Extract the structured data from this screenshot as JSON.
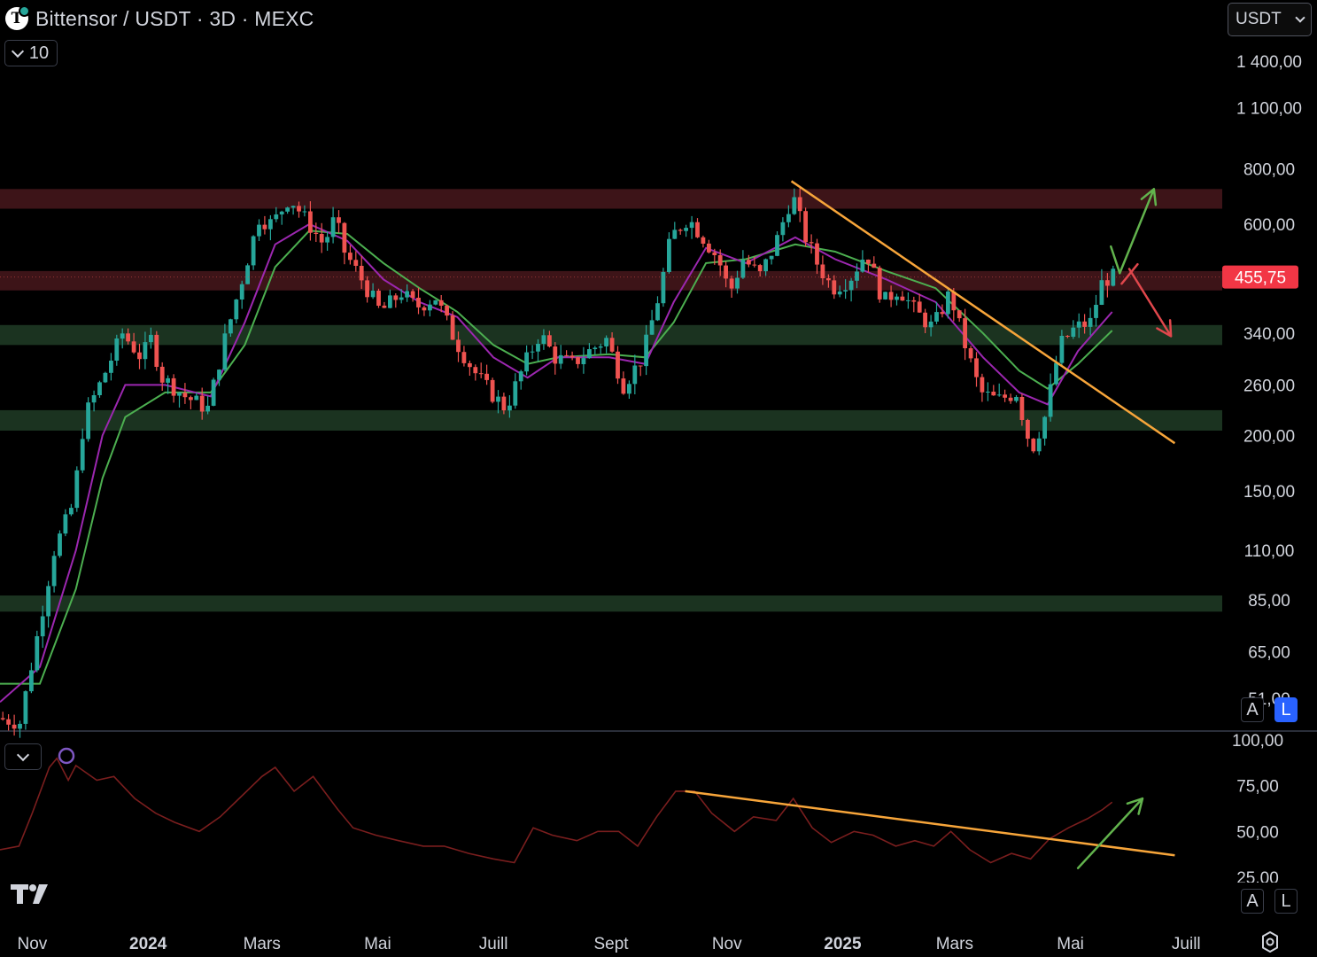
{
  "header": {
    "title": "Bittensor / USDT · 3D · MEXC",
    "logo_letter": "T",
    "period_value": "10",
    "currency": "USDT"
  },
  "price_axis": {
    "ticks": [
      "1 400,00",
      "1 100,00",
      "800,00",
      "600,00",
      "340,00",
      "260,00",
      "200,00",
      "150,00",
      "110,00",
      "85,00",
      "65,00",
      "51,00"
    ],
    "last_price_label": "455,75",
    "last_price_color": "#f23645",
    "scale_buttons": [
      "A",
      "L"
    ]
  },
  "indicator_axis": {
    "ticks": [
      "100,00",
      "75,00",
      "50,00",
      "25,00"
    ],
    "scale_buttons": [
      "A",
      "L"
    ]
  },
  "time_axis": {
    "ticks": [
      "Nov",
      "2024",
      "Mars",
      "Mai",
      "Juill",
      "Sept",
      "Nov",
      "2025",
      "Mars",
      "Mai",
      "Juill"
    ]
  },
  "colors": {
    "up": "#26a69a",
    "down": "#ef5350",
    "ema_fast": "#9c27b0",
    "ema_slow": "#4caf50",
    "trendline": "#f7a53a",
    "resistance_zone": "#3d1418",
    "support_zone": "#1b3320",
    "rsi_line": "#7a1e1e",
    "arrow_up": "#62b34d",
    "arrow_down": "#e0474c",
    "background": "#000000"
  },
  "chart_data": {
    "type": "candlestick",
    "scale": "log",
    "x_range": [
      "2023-10-15",
      "2025-07-20"
    ],
    "y_range": [
      44,
      1600
    ],
    "x_ticks": [
      "Nov",
      "2024",
      "Mars",
      "Mai",
      "Juill",
      "Sept",
      "Nov",
      "2025",
      "Mars",
      "Mai",
      "Juill"
    ],
    "y_ticks": [
      1400,
      1100,
      800,
      600,
      340,
      260,
      200,
      150,
      110,
      85,
      65,
      51
    ],
    "last_price": 455.75,
    "price_path": [
      [
        "2023-10-15",
        46
      ],
      [
        "2023-10-27",
        45
      ],
      [
        "2023-11-05",
        70
      ],
      [
        "2023-11-14",
        110
      ],
      [
        "2023-11-24",
        140
      ],
      [
        "2023-11-30",
        220
      ],
      [
        "2023-12-08",
        260
      ],
      [
        "2023-12-20",
        340
      ],
      [
        "2023-12-30",
        300
      ],
      [
        "2024-01-04",
        330
      ],
      [
        "2024-01-10",
        270
      ],
      [
        "2024-01-22",
        245
      ],
      [
        "2024-02-03",
        230
      ],
      [
        "2024-02-12",
        330
      ],
      [
        "2024-02-21",
        450
      ],
      [
        "2024-03-01",
        620
      ],
      [
        "2024-03-08",
        600
      ],
      [
        "2024-03-17",
        690
      ],
      [
        "2024-03-26",
        610
      ],
      [
        "2024-04-04",
        540
      ],
      [
        "2024-04-10",
        620
      ],
      [
        "2024-04-15",
        520
      ],
      [
        "2024-04-24",
        450
      ],
      [
        "2024-05-04",
        380
      ],
      [
        "2024-05-15",
        420
      ],
      [
        "2024-05-23",
        390
      ],
      [
        "2024-06-02",
        410
      ],
      [
        "2024-06-12",
        330
      ],
      [
        "2024-06-22",
        280
      ],
      [
        "2024-07-01",
        250
      ],
      [
        "2024-07-09",
        230
      ],
      [
        "2024-07-19",
        290
      ],
      [
        "2024-07-27",
        340
      ],
      [
        "2024-08-04",
        300
      ],
      [
        "2024-08-13",
        290
      ],
      [
        "2024-08-22",
        310
      ],
      [
        "2024-08-31",
        330
      ],
      [
        "2024-09-09",
        260
      ],
      [
        "2024-09-19",
        300
      ],
      [
        "2024-09-28",
        420
      ],
      [
        "2024-10-04",
        560
      ],
      [
        "2024-10-13",
        620
      ],
      [
        "2024-10-21",
        560
      ],
      [
        "2024-10-29",
        500
      ],
      [
        "2024-11-04",
        420
      ],
      [
        "2024-11-11",
        500
      ],
      [
        "2024-11-20",
        460
      ],
      [
        "2024-11-28",
        540
      ],
      [
        "2024-12-07",
        700
      ],
      [
        "2024-12-14",
        560
      ],
      [
        "2024-12-20",
        490
      ],
      [
        "2024-12-28",
        430
      ],
      [
        "2025-01-06",
        450
      ],
      [
        "2025-01-15",
        520
      ],
      [
        "2025-01-24",
        400
      ],
      [
        "2025-02-01",
        430
      ],
      [
        "2025-02-10",
        380
      ],
      [
        "2025-02-19",
        350
      ],
      [
        "2025-02-28",
        420
      ],
      [
        "2025-03-07",
        330
      ],
      [
        "2025-03-16",
        250
      ],
      [
        "2025-03-25",
        240
      ],
      [
        "2025-04-04",
        250
      ],
      [
        "2025-04-12",
        185
      ],
      [
        "2025-04-19",
        220
      ],
      [
        "2025-04-27",
        320
      ],
      [
        "2025-05-05",
        350
      ],
      [
        "2025-05-13",
        360
      ],
      [
        "2025-05-19",
        440
      ],
      [
        "2025-05-23",
        455.75
      ]
    ],
    "ema_fast_path": [
      [
        "2023-10-15",
        50
      ],
      [
        "2023-11-05",
        60
      ],
      [
        "2023-11-24",
        110
      ],
      [
        "2023-12-08",
        200
      ],
      [
        "2023-12-20",
        260
      ],
      [
        "2024-01-10",
        260
      ],
      [
        "2024-02-03",
        245
      ],
      [
        "2024-02-21",
        360
      ],
      [
        "2024-03-08",
        540
      ],
      [
        "2024-03-26",
        600
      ],
      [
        "2024-04-15",
        550
      ],
      [
        "2024-05-04",
        450
      ],
      [
        "2024-05-23",
        400
      ],
      [
        "2024-06-12",
        370
      ],
      [
        "2024-07-01",
        300
      ],
      [
        "2024-07-19",
        270
      ],
      [
        "2024-08-04",
        300
      ],
      [
        "2024-08-31",
        300
      ],
      [
        "2024-09-19",
        290
      ],
      [
        "2024-10-04",
        400
      ],
      [
        "2024-10-21",
        530
      ],
      [
        "2024-11-11",
        490
      ],
      [
        "2024-12-07",
        560
      ],
      [
        "2024-12-28",
        500
      ],
      [
        "2025-01-24",
        450
      ],
      [
        "2025-02-19",
        400
      ],
      [
        "2025-03-16",
        300
      ],
      [
        "2025-04-04",
        250
      ],
      [
        "2025-04-19",
        235
      ],
      [
        "2025-05-05",
        310
      ],
      [
        "2025-05-23",
        380
      ]
    ],
    "ema_slow_path": [
      [
        "2023-10-15",
        55
      ],
      [
        "2023-11-05",
        55
      ],
      [
        "2023-11-24",
        90
      ],
      [
        "2023-12-08",
        160
      ],
      [
        "2023-12-20",
        220
      ],
      [
        "2024-01-10",
        250
      ],
      [
        "2024-02-03",
        250
      ],
      [
        "2024-02-21",
        320
      ],
      [
        "2024-03-08",
        480
      ],
      [
        "2024-03-26",
        580
      ],
      [
        "2024-04-15",
        570
      ],
      [
        "2024-05-04",
        490
      ],
      [
        "2024-05-23",
        430
      ],
      [
        "2024-06-12",
        380
      ],
      [
        "2024-07-01",
        320
      ],
      [
        "2024-07-19",
        290
      ],
      [
        "2024-08-04",
        300
      ],
      [
        "2024-08-31",
        305
      ],
      [
        "2024-09-19",
        300
      ],
      [
        "2024-10-04",
        360
      ],
      [
        "2024-10-21",
        490
      ],
      [
        "2024-11-11",
        500
      ],
      [
        "2024-12-07",
        540
      ],
      [
        "2024-12-28",
        520
      ],
      [
        "2025-01-24",
        470
      ],
      [
        "2025-02-19",
        430
      ],
      [
        "2025-03-16",
        340
      ],
      [
        "2025-04-04",
        280
      ],
      [
        "2025-04-19",
        255
      ],
      [
        "2025-05-05",
        290
      ],
      [
        "2025-05-23",
        345
      ]
    ],
    "zones": [
      {
        "kind": "resistance",
        "low": 650,
        "high": 720
      },
      {
        "kind": "resistance",
        "low": 425,
        "high": 470
      },
      {
        "kind": "support",
        "low": 320,
        "high": 355
      },
      {
        "kind": "support",
        "low": 205,
        "high": 228
      },
      {
        "kind": "support",
        "low": 80,
        "high": 87
      }
    ],
    "trendline": [
      [
        "2024-12-05",
        750
      ],
      [
        "2025-06-25",
        192
      ]
    ],
    "arrow_up": [
      [
        "2025-05-27",
        465
      ],
      [
        "2025-06-14",
        720
      ]
    ],
    "arrow_down": [
      [
        "2025-05-28",
        440
      ],
      [
        "2025-06-23",
        335
      ]
    ],
    "indicator": {
      "range": [
        25,
        100
      ],
      "ticks": [
        100,
        75,
        50,
        25
      ],
      "path": [
        [
          "2023-10-15",
          40
        ],
        [
          "2023-10-25",
          42
        ],
        [
          "2023-11-01",
          60
        ],
        [
          "2023-11-10",
          85
        ],
        [
          "2023-11-14",
          90
        ],
        [
          "2023-11-20",
          78
        ],
        [
          "2023-11-24",
          86
        ],
        [
          "2023-12-05",
          78
        ],
        [
          "2023-12-14",
          80
        ],
        [
          "2023-12-25",
          68
        ],
        [
          "2024-01-05",
          60
        ],
        [
          "2024-01-15",
          55
        ],
        [
          "2024-01-28",
          50
        ],
        [
          "2024-02-08",
          58
        ],
        [
          "2024-02-20",
          70
        ],
        [
          "2024-03-01",
          80
        ],
        [
          "2024-03-08",
          85
        ],
        [
          "2024-03-18",
          72
        ],
        [
          "2024-03-28",
          80
        ],
        [
          "2024-04-10",
          62
        ],
        [
          "2024-04-18",
          52
        ],
        [
          "2024-04-30",
          48
        ],
        [
          "2024-05-12",
          45
        ],
        [
          "2024-05-25",
          42
        ],
        [
          "2024-06-05",
          42
        ],
        [
          "2024-06-18",
          38
        ],
        [
          "2024-07-01",
          35
        ],
        [
          "2024-07-12",
          33
        ],
        [
          "2024-07-22",
          52
        ],
        [
          "2024-08-01",
          48
        ],
        [
          "2024-08-14",
          45
        ],
        [
          "2024-08-25",
          50
        ],
        [
          "2024-09-05",
          50
        ],
        [
          "2024-09-15",
          42
        ],
        [
          "2024-09-25",
          58
        ],
        [
          "2024-10-05",
          72
        ],
        [
          "2024-10-15",
          72
        ],
        [
          "2024-10-24",
          60
        ],
        [
          "2024-11-05",
          50
        ],
        [
          "2024-11-15",
          58
        ],
        [
          "2024-11-27",
          56
        ],
        [
          "2024-12-06",
          68
        ],
        [
          "2024-12-16",
          52
        ],
        [
          "2024-12-26",
          44
        ],
        [
          "2025-01-07",
          50
        ],
        [
          "2025-01-17",
          48
        ],
        [
          "2025-01-29",
          42
        ],
        [
          "2025-02-08",
          45
        ],
        [
          "2025-02-18",
          42
        ],
        [
          "2025-02-27",
          50
        ],
        [
          "2025-03-09",
          40
        ],
        [
          "2025-03-20",
          33
        ],
        [
          "2025-03-31",
          38
        ],
        [
          "2025-04-10",
          35
        ],
        [
          "2025-04-20",
          46
        ],
        [
          "2025-04-30",
          52
        ],
        [
          "2025-05-10",
          57
        ],
        [
          "2025-05-18",
          62
        ],
        [
          "2025-05-23",
          66
        ]
      ],
      "trendline": [
        [
          "2024-10-10",
          72
        ],
        [
          "2025-06-25",
          37
        ]
      ],
      "arrow": [
        [
          "2025-05-05",
          30
        ],
        [
          "2025-06-08",
          68
        ]
      ]
    }
  }
}
